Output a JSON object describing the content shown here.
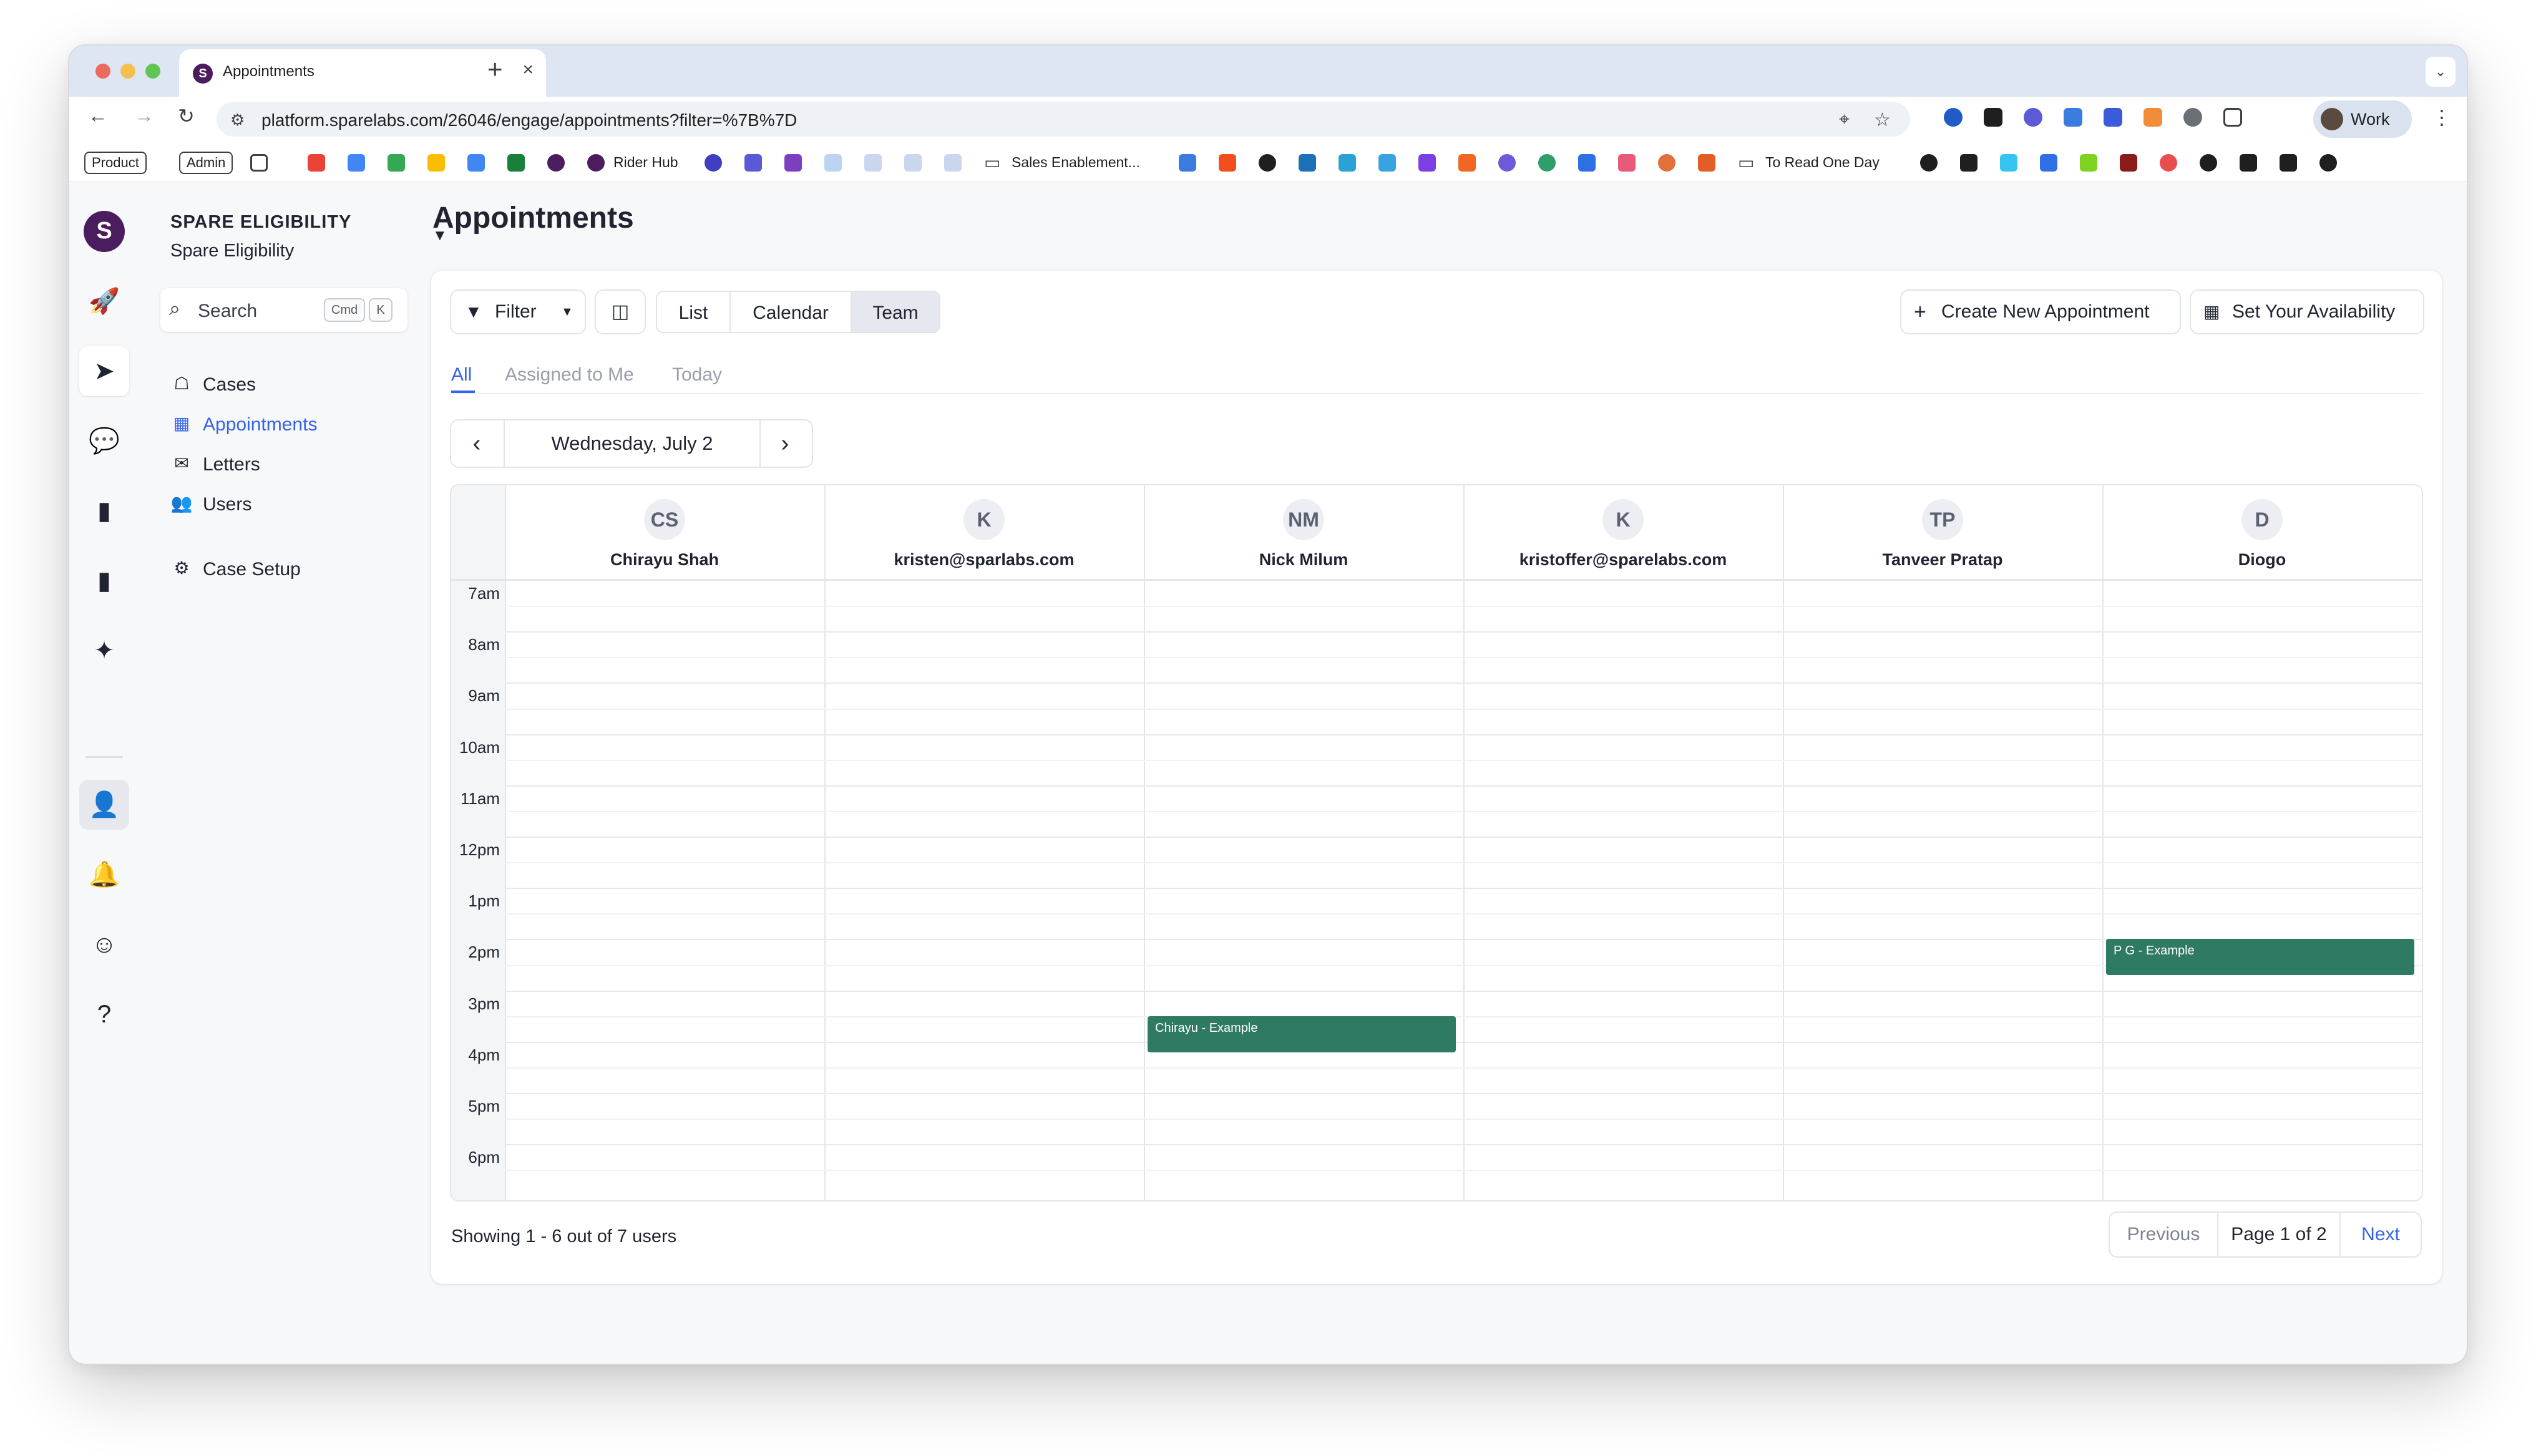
{
  "browser": {
    "tab_title": "Appointments",
    "tab_favicon": "S",
    "url": "platform.sparelabs.com/26046/engage/appointments?filter=%7B%7D",
    "profile_name": "Work",
    "bookmarks": {
      "product": "Product",
      "admin": "Admin",
      "rider_hub": "Rider Hub",
      "sales": "Sales Enablement...",
      "to_read": "To Read One Day"
    }
  },
  "rail": {
    "logo": "S"
  },
  "sidebar": {
    "org_name": "SPARE ELIGIBILITY",
    "org_sub": "Spare Eligibility",
    "search_placeholder": "Search",
    "kbd_cmd": "Cmd",
    "kbd_k": "K",
    "items": [
      {
        "label": "Cases",
        "icon": "inbox-icon",
        "active": false
      },
      {
        "label": "Appointments",
        "icon": "calendar-icon",
        "active": true
      },
      {
        "label": "Letters",
        "icon": "envelope-icon",
        "active": false
      },
      {
        "label": "Users",
        "icon": "users-icon",
        "active": false
      }
    ],
    "setup_label": "Case Setup"
  },
  "main": {
    "title": "Appointments",
    "filter_label": "Filter",
    "views": [
      "List",
      "Calendar",
      "Team"
    ],
    "selected_view": "Team",
    "create_label": "Create New Appointment",
    "availability_label": "Set Your Availability",
    "subtabs": [
      "All",
      "Assigned to Me",
      "Today"
    ],
    "active_subtab": "All",
    "date_label": "Wednesday, July 2"
  },
  "team_calendar": {
    "users": [
      {
        "initials": "CS",
        "name": "Chirayu Shah"
      },
      {
        "initials": "K",
        "name": "kristen@sparlabs.com"
      },
      {
        "initials": "NM",
        "name": "Nick Milum"
      },
      {
        "initials": "K",
        "name": "kristoffer@sparelabs.com"
      },
      {
        "initials": "TP",
        "name": "Tanveer Pratap"
      },
      {
        "initials": "D",
        "name": "Diogo"
      }
    ],
    "hours": [
      "7am",
      "8am",
      "9am",
      "10am",
      "11am",
      "12pm",
      "1pm",
      "2pm",
      "3pm",
      "4pm",
      "5pm",
      "6pm"
    ],
    "events": [
      {
        "title": "Chirayu - Example",
        "user": "Nick Milum",
        "start_hour": 15.5,
        "end_hour": 16.25
      },
      {
        "title": "P G - Example",
        "user": "Diogo",
        "start_hour": 14.0,
        "end_hour": 14.75
      }
    ],
    "event_color": "#2e7a63"
  },
  "footer": {
    "showing": "Showing 1 - 6 out of 7 users",
    "previous": "Previous",
    "page": "Page 1 of 2",
    "next": "Next"
  },
  "colors": {
    "accent": "#3563e9",
    "brand": "#4b1c5e",
    "event": "#2e7a63"
  }
}
